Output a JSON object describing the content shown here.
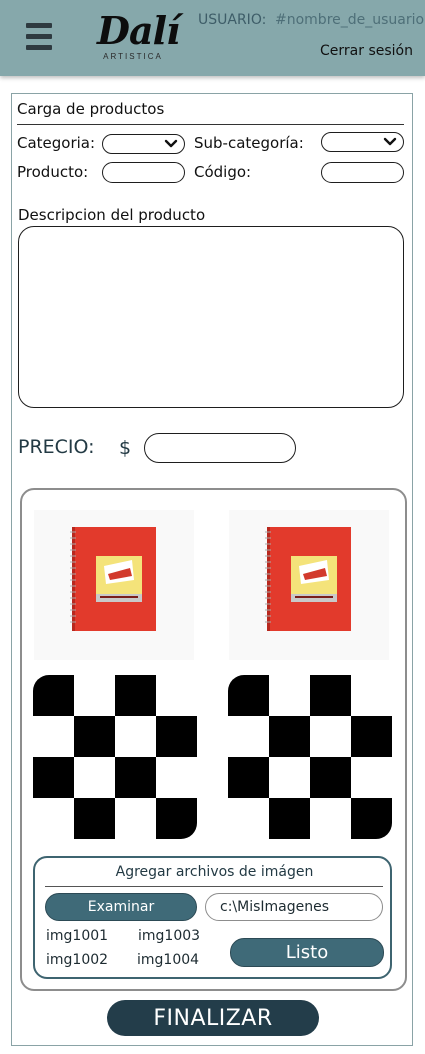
{
  "header": {
    "logo_text": "Dalí",
    "logo_subtext": "ARTISTICA",
    "user_label": "USUARIO:",
    "user_name": "#nombre_de_usuario",
    "logout_label": "Cerrar sesión",
    "icons": {
      "menu": "hamburger-menu-icon"
    }
  },
  "form": {
    "title": "Carga de productos",
    "category_label": "Categoria:",
    "category_value": "",
    "subcategory_label": "Sub-categoría:",
    "subcategory_value": "",
    "product_label": "Producto:",
    "product_value": "",
    "code_label": "Código:",
    "code_value": "",
    "description_label": "Descripcion del producto",
    "description_value": "",
    "price_label": "PRECIO:",
    "currency_symbol": "$",
    "price_value": ""
  },
  "gallery": {
    "thumbnails": [
      "notebook-image",
      "notebook-image",
      "placeholder-image",
      "placeholder-image"
    ]
  },
  "upload": {
    "title": "Agregar archivos de imágen",
    "browse_label": "Examinar",
    "path_value": "c:\\MisImagenes",
    "files": [
      "img1001",
      "img1003",
      "img1002",
      "img1004"
    ],
    "done_label": "Listo"
  },
  "finish_label": "FINALIZAR",
  "colors": {
    "header_bg": "#86a8ab",
    "accent": "#3f6a78",
    "primary_dark": "#233d4a"
  }
}
